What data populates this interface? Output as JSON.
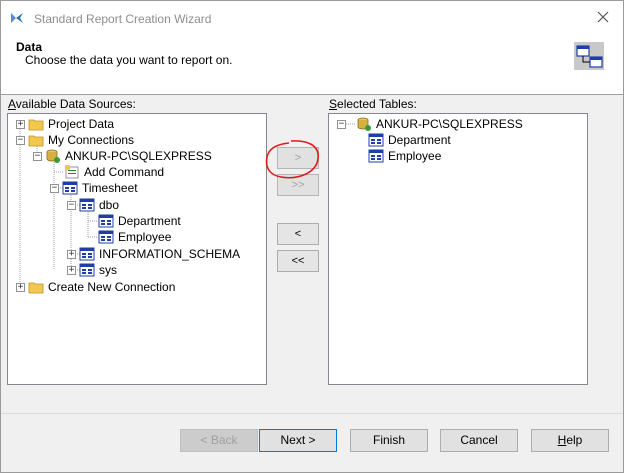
{
  "window": {
    "title": "Standard Report Creation Wizard"
  },
  "header": {
    "title": "Data",
    "description": "Choose the data you want to report on."
  },
  "available": {
    "label_prefix": "",
    "label_underline": "A",
    "label_rest": "vailable Data Sources:",
    "items": [
      {
        "label": "Project Data"
      },
      {
        "label": "My Connections"
      },
      {
        "label": "ANKUR-PC\\SQLEXPRESS"
      },
      {
        "label": "Add Command"
      },
      {
        "label": "Timesheet"
      },
      {
        "label": "dbo"
      },
      {
        "label": "Department"
      },
      {
        "label": "Employee"
      },
      {
        "label": "INFORMATION_SCHEMA"
      },
      {
        "label": "sys"
      },
      {
        "label": "Create New Connection"
      }
    ]
  },
  "selected": {
    "label_prefix": "",
    "label_underline": "S",
    "label_rest": "elected Tables:",
    "items": [
      {
        "label": "ANKUR-PC\\SQLEXPRESS"
      },
      {
        "label": "Department"
      },
      {
        "label": "Employee"
      }
    ]
  },
  "transfer_buttons": {
    "add": ">",
    "add_all": ">>",
    "remove": "<",
    "remove_all": "<<"
  },
  "footer": {
    "back": "< Back",
    "next": "Next >",
    "finish": "Finish",
    "cancel": "Cancel",
    "help_underline": "H",
    "help_rest": "elp"
  },
  "colors": {
    "annotation": "#e01b1b",
    "folder": "#f2c94c",
    "table_icon": "#1f3fa6"
  }
}
